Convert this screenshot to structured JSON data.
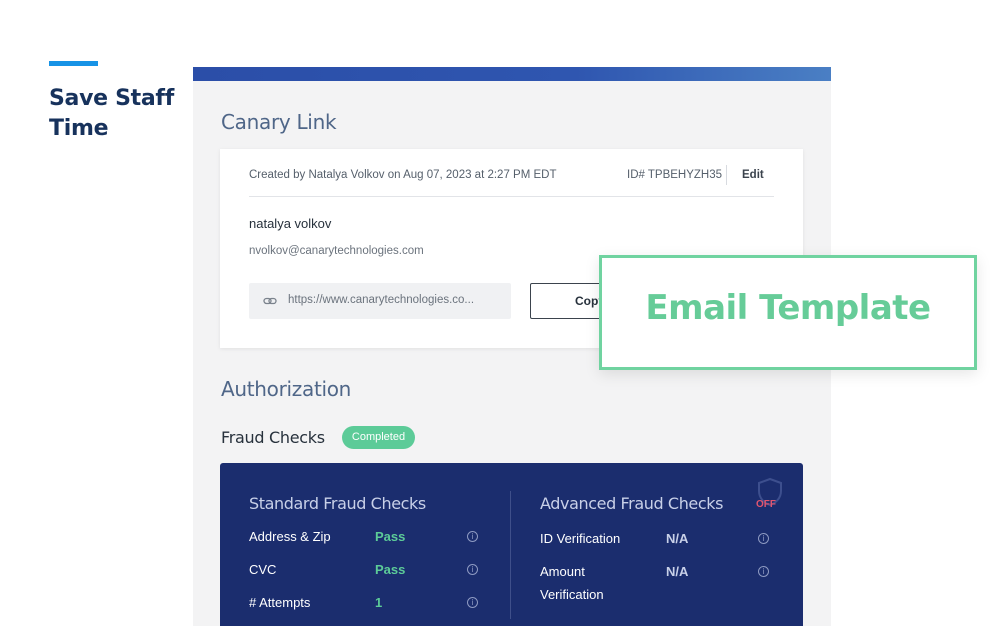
{
  "side": {
    "heading": "Save Staff Time",
    "accent_color": "#1793e6"
  },
  "panel": {
    "canary_link_title": "Canary Link",
    "authorization_title": "Authorization"
  },
  "link_card": {
    "created": "Created by Natalya Volkov on Aug 07, 2023 at 2:27 PM EDT",
    "id": "ID# TPBEHYZH35",
    "edit_label": "Edit",
    "guest_name": "natalya volkov",
    "guest_email": "nvolkov@canarytechnologies.com",
    "url": "https://www.canarytechnologies.co...",
    "copy_label": "Copy",
    "link_icon": "link-icon"
  },
  "fraud": {
    "label": "Fraud Checks",
    "status": "Completed",
    "status_color": "#5ccb98",
    "standard": {
      "title": "Standard Fraud Checks",
      "rows": [
        {
          "label": "Address & Zip",
          "value": "Pass"
        },
        {
          "label": "CVC",
          "value": "Pass"
        },
        {
          "label": "# Attempts",
          "value": "1"
        }
      ]
    },
    "advanced": {
      "title": "Advanced Fraud Checks",
      "off_label": "OFF",
      "rows": [
        {
          "label": "ID Verification",
          "value": "N/A"
        },
        {
          "label_line1": "Amount",
          "label_line2": "Verification",
          "value": "N/A"
        }
      ]
    },
    "info_icon": "info-icon",
    "shield_icon": "shield-icon"
  },
  "callout": {
    "text": "Email Template",
    "color": "#66cc98"
  }
}
